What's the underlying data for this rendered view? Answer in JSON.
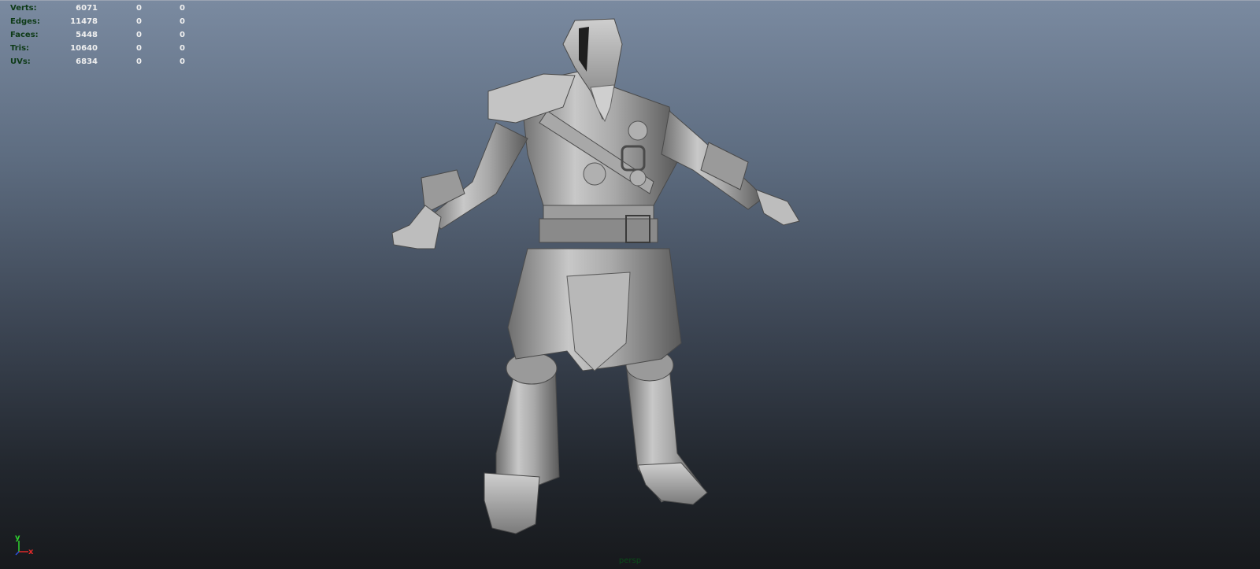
{
  "hud": {
    "rows": [
      {
        "label": "Verts:",
        "v1": "6071",
        "v2": "0",
        "v3": "0"
      },
      {
        "label": "Edges:",
        "v1": "11478",
        "v2": "0",
        "v3": "0"
      },
      {
        "label": "Faces:",
        "v1": "5448",
        "v2": "0",
        "v3": "0"
      },
      {
        "label": "Tris:",
        "v1": "10640",
        "v2": "0",
        "v3": "0"
      },
      {
        "label": "UVs:",
        "v1": "6834",
        "v2": "0",
        "v3": "0"
      }
    ]
  },
  "camera": {
    "label": "persp"
  },
  "axis": {
    "y_label": "y",
    "x_label": "x",
    "y_color": "#2fd12f",
    "x_color": "#e02a2a"
  },
  "colors": {
    "hud_label": "#0d3a16",
    "camera_label": "#0b4b19"
  },
  "model": {
    "icon": "character-mesh"
  }
}
